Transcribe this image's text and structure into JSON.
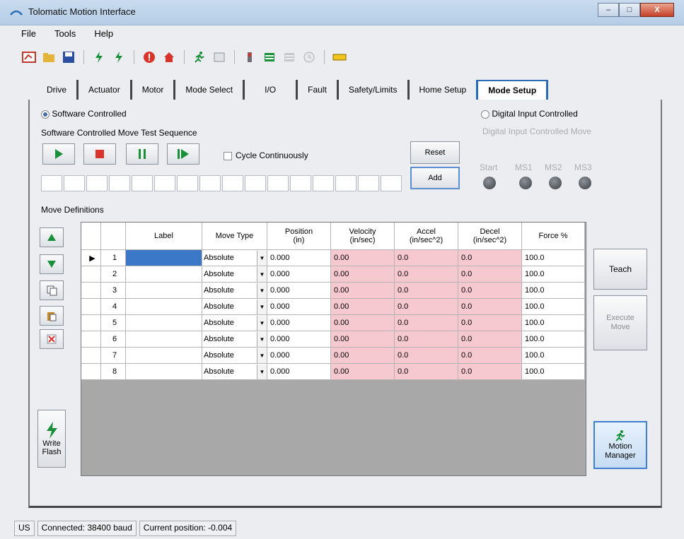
{
  "window": {
    "title": "Tolomatic Motion Interface",
    "min": "–",
    "max": "□",
    "close": "X"
  },
  "menu": [
    "File",
    "Tools",
    "Help"
  ],
  "toolbar": {
    "icons": [
      "connect-icon",
      "save-icon",
      "disk-icon",
      "bolt-icon",
      "bolt-icon",
      "error-icon",
      "home-icon",
      "run-icon",
      "table-icon",
      "io-icon",
      "grid-icon",
      "grid2-icon",
      "clock-icon",
      "battery-icon"
    ]
  },
  "tabs": [
    "Drive",
    "Actuator",
    "Motor",
    "Mode Select",
    "I/O",
    "Fault",
    "Safety/Limits",
    "Home Setup",
    "Mode Setup"
  ],
  "mode": {
    "software": "Software Controlled",
    "digital": "Digital Input Controlled",
    "sequence": "Software Controlled Move Test Sequence",
    "digital_move": "Digital Input Controlled Move",
    "cycle": "Cycle Continuously",
    "reset": "Reset",
    "add": "Add",
    "leds": [
      "Start",
      "MS1",
      "MS2",
      "MS3"
    ]
  },
  "moves": {
    "title": "Move Definitions",
    "headers": [
      "",
      "",
      "Label",
      "Move Type",
      "Position\n(in)",
      "Velocity\n(in/sec)",
      "Accel\n(in/sec^2)",
      "Decel\n(in/sec^2)",
      "Force %"
    ],
    "rows": [
      {
        "n": "1",
        "label": "",
        "type": "Absolute",
        "pos": "0.000",
        "vel": "0.00",
        "acc": "0.0",
        "dec": "0.0",
        "force": "100.0"
      },
      {
        "n": "2",
        "label": "",
        "type": "Absolute",
        "pos": "0.000",
        "vel": "0.00",
        "acc": "0.0",
        "dec": "0.0",
        "force": "100.0"
      },
      {
        "n": "3",
        "label": "",
        "type": "Absolute",
        "pos": "0.000",
        "vel": "0.00",
        "acc": "0.0",
        "dec": "0.0",
        "force": "100.0"
      },
      {
        "n": "4",
        "label": "",
        "type": "Absolute",
        "pos": "0.000",
        "vel": "0.00",
        "acc": "0.0",
        "dec": "0.0",
        "force": "100.0"
      },
      {
        "n": "5",
        "label": "",
        "type": "Absolute",
        "pos": "0.000",
        "vel": "0.00",
        "acc": "0.0",
        "dec": "0.0",
        "force": "100.0"
      },
      {
        "n": "6",
        "label": "",
        "type": "Absolute",
        "pos": "0.000",
        "vel": "0.00",
        "acc": "0.0",
        "dec": "0.0",
        "force": "100.0"
      },
      {
        "n": "7",
        "label": "",
        "type": "Absolute",
        "pos": "0.000",
        "vel": "0.00",
        "acc": "0.0",
        "dec": "0.0",
        "force": "100.0"
      },
      {
        "n": "8",
        "label": "",
        "type": "Absolute",
        "pos": "0.000",
        "vel": "0.00",
        "acc": "0.0",
        "dec": "0.0",
        "force": "100.0"
      }
    ]
  },
  "buttons": {
    "teach": "Teach",
    "execute": "Execute Move",
    "motion": "Motion Manager",
    "write": "Write Flash"
  },
  "status": {
    "locale": "US",
    "conn": "Connected: 38400 baud",
    "pos": "Current position: -0.004"
  }
}
